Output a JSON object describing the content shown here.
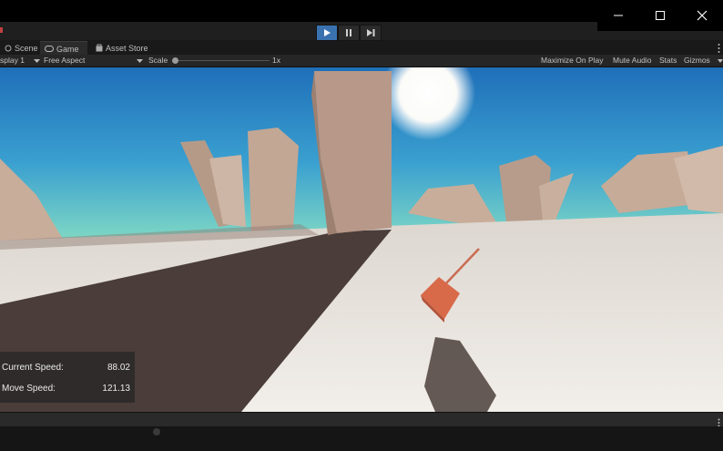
{
  "window": {
    "controls": {
      "minimize_icon": "minimize-icon",
      "maximize_icon": "maximize-icon",
      "close_icon": "close-icon"
    }
  },
  "toolbar": {
    "play_icon": "play-icon",
    "pause_icon": "pause-icon",
    "step_icon": "step-icon",
    "accent_color": "#3a72b0"
  },
  "tabs": [
    {
      "label": "Scene",
      "icon": "scene-icon"
    },
    {
      "label": "Game",
      "icon": "gamepad-icon"
    },
    {
      "label": "Asset Store",
      "icon": "bag-icon"
    }
  ],
  "game_bar": {
    "display": "splay 1",
    "aspect": "Free Aspect",
    "scale_label": "Scale",
    "scale_value": "1x",
    "maximize_on_play": "Maximize On Play",
    "mute_audio": "Mute Audio",
    "stats": "Stats",
    "gizmos": "Gizmos"
  },
  "hud": {
    "current_speed_label": "Current Speed:",
    "current_speed_value": "88.02",
    "move_speed_label": "Move Speed:",
    "move_speed_value": "121.13"
  },
  "scene_colors": {
    "sky_top": "#1f6fb8",
    "sky_horizon": "#6fd0c8",
    "ground": "#e9e4df",
    "shadow": "#4a3a38",
    "pillar": "#c9b0a0",
    "cube": "#d86a4a"
  }
}
